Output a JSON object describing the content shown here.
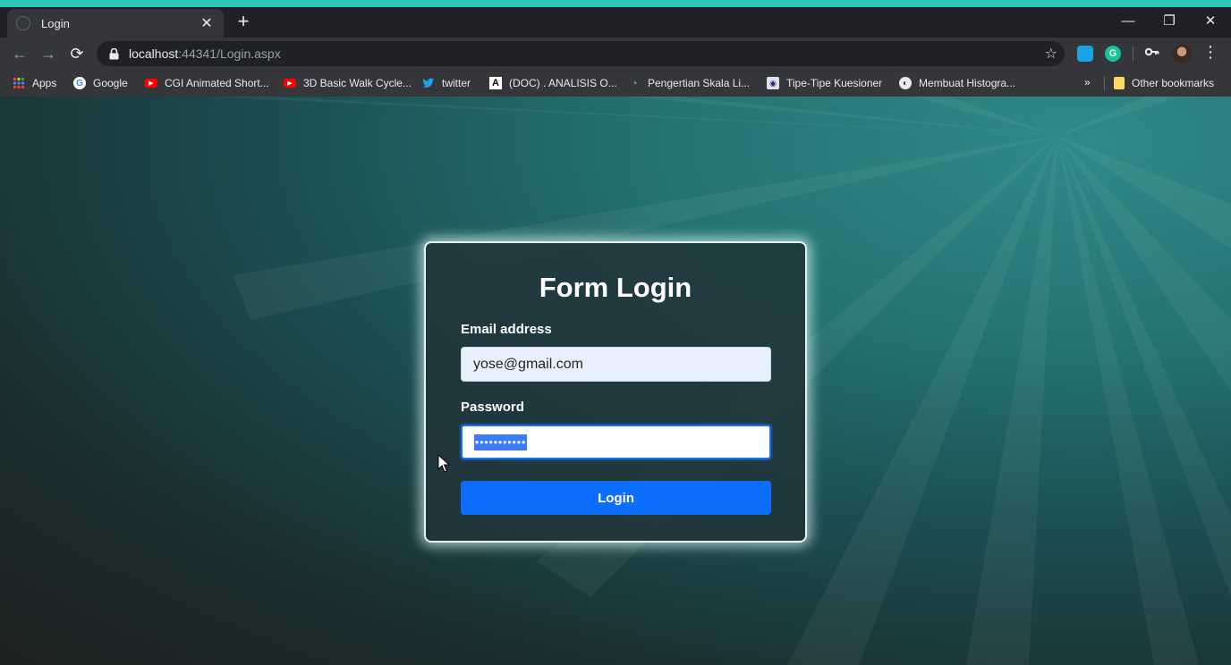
{
  "browser": {
    "tab": {
      "title": "Login"
    },
    "address": {
      "host": "localhost",
      "rest": ":44341/Login.aspx"
    },
    "bookmarks": [
      {
        "label": "Apps",
        "icon": "apps-grid-icon"
      },
      {
        "label": "Google",
        "icon": "google-icon"
      },
      {
        "label": "CGI Animated Short...",
        "icon": "youtube-icon"
      },
      {
        "label": "3D Basic Walk Cycle...",
        "icon": "youtube-icon"
      },
      {
        "label": "twitter",
        "icon": "twitter-icon"
      },
      {
        "label": "(DOC) . ANALISIS O...",
        "icon": "academia-icon"
      },
      {
        "label": "Pengertian Skala Li...",
        "icon": "site-icon"
      },
      {
        "label": "Tipe-Tipe Kuesioner",
        "icon": "site-icon"
      },
      {
        "label": "Membuat Histogra...",
        "icon": "globe-icon"
      }
    ],
    "other_bookmarks": "Other bookmarks"
  },
  "form": {
    "title": "Form Login",
    "email_label": "Email address",
    "email_value": "yose@gmail.com",
    "password_label": "Password",
    "password_mask": "•••••••••••",
    "submit_label": "Login"
  },
  "colors": {
    "accent": "#2ec4b6",
    "primary_button": "#0d6efd",
    "card_border": "#e9f2f2"
  }
}
